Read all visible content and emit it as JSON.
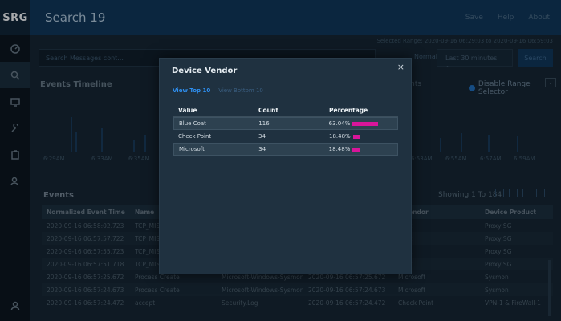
{
  "app": {
    "logo": "SRG",
    "title": "Search 19",
    "nav": [
      "Save",
      "Help",
      "About"
    ]
  },
  "search": {
    "range_text": "Selected Range: 2020-09-16 06:29:03 to 2020-09-16 06:59:03",
    "placeholder": "Search Messages cont...",
    "fields_label": "Normal Fields",
    "time_range": "Last 30 minutes",
    "search_label": "Search"
  },
  "timeline": {
    "title": "Events Timeline",
    "right_label": "g Events",
    "disable_range_label": "Disable Range Selector",
    "ticks": [
      "6:29AM",
      "6:33AM",
      "6:35AM",
      "6:53AM",
      "6:55AM",
      "6:57AM",
      "6:59AM"
    ]
  },
  "events": {
    "title": "Events",
    "showing": "Showing 1 To 184",
    "columns": [
      "Normalized Event Time",
      "Name",
      "",
      "",
      "e Vendor",
      "Device Product"
    ],
    "rows": [
      [
        "2020-09-16 06:58:02.723",
        "TCP_MISS",
        "",
        "",
        "Coat",
        "Proxy SG"
      ],
      [
        "2020-09-16 06:57:57.722",
        "TCP_MISS",
        "",
        "",
        "Coat",
        "Proxy SG"
      ],
      [
        "2020-09-16 06:57:55.723",
        "TCP_MISS",
        "",
        "",
        "Coat",
        "Proxy SG"
      ],
      [
        "2020-09-16 06:57:51.718",
        "TCP_MISS",
        "",
        "",
        "Coat",
        "Proxy SG"
      ],
      [
        "2020-09-16 06:57:25.672",
        "Process Create",
        "Microsoft-Windows-Sysmon/...",
        "2020-09-16 06:57:25.672",
        "Microsoft",
        "Sysmon"
      ],
      [
        "2020-09-16 06:57:24.673",
        "Process Create",
        "Microsoft-Windows-Sysmon/...",
        "2020-09-16 06:57:24.673",
        "Microsoft",
        "Sysmon"
      ],
      [
        "2020-09-16 06:57:24.472",
        "accept",
        "Security.Log",
        "2020-09-16 06:57:24.472",
        "Check Point",
        "VPN-1 & FireWall-1"
      ]
    ]
  },
  "modal": {
    "title": "Device Vendor",
    "close": "×",
    "tab_top": "View Top 10",
    "tab_bottom": "View Bottom 10",
    "headers": {
      "value": "Value",
      "count": "Count",
      "percentage": "Percentage"
    },
    "rows": [
      {
        "value": "Blue Coat",
        "count": "116",
        "percentage": "63.04%",
        "pct": 63.04
      },
      {
        "value": "Check Point",
        "count": "34",
        "percentage": "18.48%",
        "pct": 18.48
      },
      {
        "value": "Microsoft",
        "count": "34",
        "percentage": "18.48%",
        "pct": 18.48
      }
    ],
    "bar_color": "#d8159a"
  }
}
